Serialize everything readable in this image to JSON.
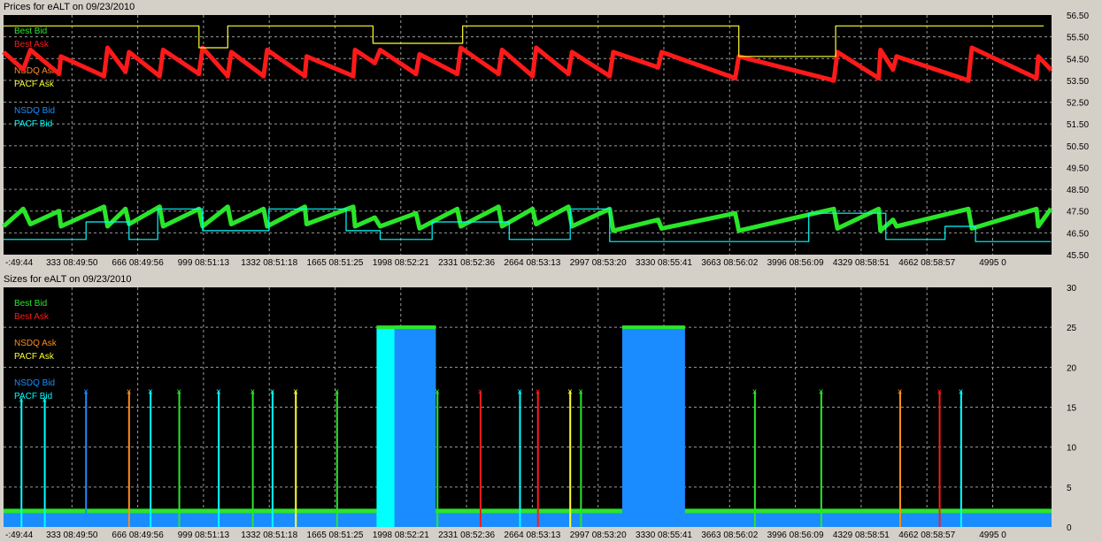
{
  "window": {
    "title_prices": "Prices for  eALT  on  09/23/2010",
    "title_sizes": "Sizes for  eALT  on  09/23/2010"
  },
  "colors": {
    "best_bid": "#29e629",
    "best_ask": "#ff1a1a",
    "nsdq_ask": "#ff8c1a",
    "pacf_ask": "#ffff33",
    "nsdq_bid": "#1a8cff",
    "pacf_bid": "#00ffff",
    "plot_bg": "#000000",
    "grid": "#9a9a9a"
  },
  "x_ticks": [
    "-:49:44",
    "333 08:49:50",
    "666 08:49:56",
    "999 08:51:13",
    "1332 08:51:18",
    "1665 08:51:25",
    "1998 08:52:21",
    "2331 08:52:36",
    "2664 08:53:13",
    "2997 08:53:20",
    "3330 08:55:41",
    "3663 08:56:02",
    "3996 08:56:09",
    "4329 08:58:51",
    "4662 08:58:57",
    "4995 0"
  ],
  "chart_data": [
    {
      "type": "line",
      "title": "Prices for  eALT  on  09/23/2010",
      "xlim": [
        0,
        4995
      ],
      "ylim": [
        45.5,
        56.5
      ],
      "y_ticks": [
        "56.50",
        "55.50",
        "54.50",
        "53.50",
        "52.50",
        "51.50",
        "50.50",
        "49.50",
        "48.50",
        "47.50",
        "46.50",
        "45.50"
      ],
      "legend": [
        "Best Bid",
        "Best Ask",
        "NSDQ Ask",
        "PACF Ask",
        "NSDQ Bid",
        "PACF Bid"
      ],
      "legend_position": "top-left",
      "grid": true,
      "series": [
        {
          "name": "Best Ask",
          "color": "#ff1a1a",
          "kind": "sawtooth",
          "points": [
            [
              0,
              54.8
            ],
            [
              110,
              54.0
            ],
            [
              150,
              54.9
            ],
            [
              310,
              53.8
            ],
            [
              320,
              54.6
            ],
            [
              560,
              53.7
            ],
            [
              580,
              55.0
            ],
            [
              680,
              53.9
            ],
            [
              700,
              54.8
            ],
            [
              870,
              53.7
            ],
            [
              890,
              54.9
            ],
            [
              1090,
              53.8
            ],
            [
              1110,
              55.0
            ],
            [
              1250,
              53.7
            ],
            [
              1270,
              54.8
            ],
            [
              1450,
              53.7
            ],
            [
              1470,
              54.9
            ],
            [
              1680,
              53.7
            ],
            [
              1690,
              54.6
            ],
            [
              1950,
              53.7
            ],
            [
              1960,
              54.9
            ],
            [
              2070,
              54.3
            ],
            [
              2100,
              54.9
            ],
            [
              2300,
              53.8
            ],
            [
              2320,
              54.7
            ],
            [
              2530,
              53.8
            ],
            [
              2550,
              55.0
            ],
            [
              2760,
              53.8
            ],
            [
              2780,
              54.9
            ],
            [
              2950,
              53.7
            ],
            [
              2970,
              55.0
            ],
            [
              3150,
              53.8
            ],
            [
              3170,
              54.8
            ],
            [
              3380,
              53.7
            ],
            [
              3400,
              54.8
            ],
            [
              3650,
              54.1
            ],
            [
              3670,
              54.8
            ],
            [
              4080,
              53.6
            ],
            [
              4100,
              54.6
            ],
            [
              4630,
              53.5
            ],
            [
              4650,
              54.8
            ],
            [
              4880,
              53.6
            ],
            [
              4890,
              54.9
            ],
            [
              4960,
              54.0
            ],
            [
              4980,
              54.6
            ],
            [
              5380,
              53.5
            ],
            [
              5400,
              55.0
            ],
            [
              5760,
              53.6
            ],
            [
              5770,
              54.6
            ],
            [
              5840,
              54.0
            ]
          ]
        },
        {
          "name": "PACF Ask",
          "color": "#ffff33",
          "kind": "step",
          "points": [
            [
              0,
              56.0
            ],
            [
              1090,
              56.0
            ],
            [
              1090,
              55.0
            ],
            [
              1250,
              55.0
            ],
            [
              1250,
              56.0
            ],
            [
              2060,
              56.0
            ],
            [
              2060,
              55.2
            ],
            [
              2560,
              55.2
            ],
            [
              2560,
              56.0
            ],
            [
              4100,
              56.0
            ],
            [
              4100,
              54.6
            ],
            [
              4640,
              54.6
            ],
            [
              4640,
              56.0
            ],
            [
              5800,
              56.0
            ]
          ]
        },
        {
          "name": "Best Bid",
          "color": "#29e629",
          "kind": "sawtooth",
          "points": [
            [
              0,
              46.8
            ],
            [
              110,
              47.6
            ],
            [
              150,
              46.9
            ],
            [
              310,
              47.5
            ],
            [
              320,
              46.8
            ],
            [
              560,
              47.7
            ],
            [
              580,
              46.8
            ],
            [
              680,
              47.6
            ],
            [
              700,
              46.9
            ],
            [
              870,
              47.7
            ],
            [
              890,
              46.8
            ],
            [
              1090,
              47.6
            ],
            [
              1110,
              46.8
            ],
            [
              1250,
              47.7
            ],
            [
              1270,
              46.9
            ],
            [
              1450,
              47.6
            ],
            [
              1470,
              46.8
            ],
            [
              1680,
              47.7
            ],
            [
              1690,
              46.9
            ],
            [
              1950,
              47.7
            ],
            [
              1960,
              46.8
            ],
            [
              2070,
              47.2
            ],
            [
              2100,
              46.8
            ],
            [
              2300,
              47.4
            ],
            [
              2320,
              46.7
            ],
            [
              2530,
              47.6
            ],
            [
              2550,
              46.8
            ],
            [
              2760,
              47.7
            ],
            [
              2780,
              46.8
            ],
            [
              2950,
              47.6
            ],
            [
              2970,
              46.9
            ],
            [
              3150,
              47.7
            ],
            [
              3170,
              46.8
            ],
            [
              3380,
              47.6
            ],
            [
              3400,
              46.6
            ],
            [
              3650,
              47.1
            ],
            [
              3670,
              46.7
            ],
            [
              4080,
              47.4
            ],
            [
              4100,
              46.6
            ],
            [
              4630,
              47.6
            ],
            [
              4650,
              46.7
            ],
            [
              4880,
              47.6
            ],
            [
              4890,
              46.6
            ],
            [
              4960,
              47.1
            ],
            [
              4980,
              46.8
            ],
            [
              5380,
              47.6
            ],
            [
              5400,
              46.7
            ],
            [
              5760,
              47.6
            ],
            [
              5770,
              46.8
            ],
            [
              5840,
              47.6
            ]
          ]
        },
        {
          "name": "PACF Bid",
          "color": "#00ffff",
          "kind": "step",
          "points": [
            [
              0,
              46.2
            ],
            [
              460,
              46.2
            ],
            [
              460,
              47.0
            ],
            [
              700,
              47.0
            ],
            [
              700,
              46.2
            ],
            [
              860,
              46.2
            ],
            [
              860,
              47.6
            ],
            [
              1110,
              47.6
            ],
            [
              1110,
              46.6
            ],
            [
              1480,
              46.6
            ],
            [
              1480,
              47.6
            ],
            [
              1910,
              47.6
            ],
            [
              1910,
              46.6
            ],
            [
              2100,
              46.6
            ],
            [
              2100,
              46.2
            ],
            [
              2390,
              46.2
            ],
            [
              2390,
              47.0
            ],
            [
              2820,
              47.0
            ],
            [
              2820,
              46.2
            ],
            [
              3160,
              46.2
            ],
            [
              3160,
              47.6
            ],
            [
              3380,
              47.6
            ],
            [
              3380,
              46.1
            ],
            [
              4490,
              46.1
            ],
            [
              4490,
              47.4
            ],
            [
              4920,
              47.4
            ],
            [
              4920,
              46.2
            ],
            [
              5250,
              46.2
            ],
            [
              5250,
              46.8
            ],
            [
              5420,
              46.8
            ],
            [
              5420,
              46.1
            ],
            [
              5840,
              46.1
            ]
          ]
        }
      ]
    },
    {
      "type": "bar",
      "title": "Sizes for  eALT  on  09/23/2010",
      "xlim": [
        0,
        4995
      ],
      "ylim": [
        0,
        30
      ],
      "y_ticks": [
        "30",
        "25",
        "20",
        "15",
        "10",
        "5",
        "0"
      ],
      "legend": [
        "Best Bid",
        "Best Ask",
        "NSDQ Ask",
        "PACF Ask",
        "NSDQ Bid",
        "PACF Bid"
      ],
      "legend_position": "top-left",
      "grid": true,
      "baseline_bid": 2.0,
      "spikes": [
        {
          "x": 100,
          "value": 16,
          "color": "#00ffff"
        },
        {
          "x": 230,
          "value": 16,
          "color": "#00ffff"
        },
        {
          "x": 460,
          "value": 17,
          "color": "#1a8cff"
        },
        {
          "x": 700,
          "value": 17,
          "color": "#ff8c1a"
        },
        {
          "x": 820,
          "value": 17,
          "color": "#00ffff"
        },
        {
          "x": 980,
          "value": 17,
          "color": "#29e629"
        },
        {
          "x": 1200,
          "value": 17,
          "color": "#00ffff"
        },
        {
          "x": 1390,
          "value": 17,
          "color": "#29e629"
        },
        {
          "x": 1500,
          "value": 17,
          "color": "#00ffff"
        },
        {
          "x": 1630,
          "value": 17,
          "color": "#ffff33"
        },
        {
          "x": 1860,
          "value": 17,
          "color": "#29e629"
        },
        {
          "x": 2420,
          "value": 17,
          "color": "#29e629"
        },
        {
          "x": 2660,
          "value": 17,
          "color": "#ff1a1a"
        },
        {
          "x": 2880,
          "value": 17,
          "color": "#00ffff"
        },
        {
          "x": 2980,
          "value": 17,
          "color": "#ff1a1a"
        },
        {
          "x": 3160,
          "value": 17,
          "color": "#ffff33"
        },
        {
          "x": 3220,
          "value": 17,
          "color": "#29e629"
        },
        {
          "x": 4190,
          "value": 17,
          "color": "#29e629"
        },
        {
          "x": 4560,
          "value": 17,
          "color": "#29e629"
        },
        {
          "x": 5000,
          "value": 17,
          "color": "#ff8c1a"
        },
        {
          "x": 5220,
          "value": 17,
          "color": "#ff1a1a"
        },
        {
          "x": 5340,
          "value": 17,
          "color": "#00ffff"
        }
      ],
      "blocks": [
        {
          "x0": 2080,
          "x1": 2410,
          "value": 25,
          "color": "#00ffff"
        },
        {
          "x0": 2180,
          "x1": 2410,
          "value": 25,
          "color": "#1a8cff"
        },
        {
          "x0": 3450,
          "x1": 3800,
          "value": 25,
          "color": "#1a8cff"
        }
      ]
    }
  ]
}
